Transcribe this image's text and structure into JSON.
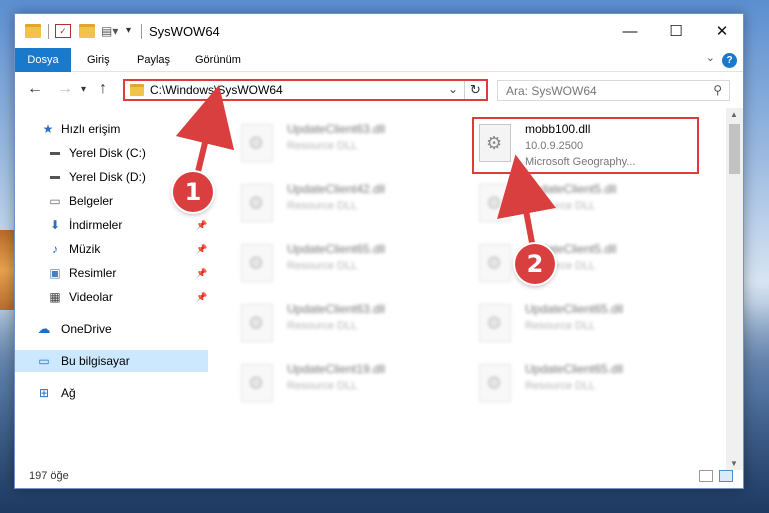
{
  "window": {
    "title": "SysWOW64"
  },
  "ribbon": {
    "tabs": [
      "Dosya",
      "Giriş",
      "Paylaş",
      "Görünüm"
    ]
  },
  "address": {
    "path": "C:\\Windows\\SysWOW64"
  },
  "search": {
    "placeholder": "Ara: SysWOW64"
  },
  "sidebar": {
    "items": [
      {
        "label": "Hızlı erişim",
        "icon": "star-icon"
      },
      {
        "label": "Yerel Disk (C:)",
        "icon": "drive-icon"
      },
      {
        "label": "Yerel Disk (D:)",
        "icon": "drive-icon"
      },
      {
        "label": "Belgeler",
        "icon": "documents-icon"
      },
      {
        "label": "İndirmeler",
        "icon": "download-icon"
      },
      {
        "label": "Müzik",
        "icon": "music-icon"
      },
      {
        "label": "Resimler",
        "icon": "pictures-icon"
      },
      {
        "label": "Videolar",
        "icon": "videos-icon"
      },
      {
        "label": "OneDrive",
        "icon": "cloud-icon"
      },
      {
        "label": "Bu bilgisayar",
        "icon": "computer-icon"
      },
      {
        "label": "Ağ",
        "icon": "network-icon"
      }
    ]
  },
  "files": [
    {
      "name": "UpdateClient63.dll",
      "type": "Resource DLL",
      "blurred": true
    },
    {
      "name": "mobb100.dll",
      "version": "10.0.9.2500",
      "description": "Microsoft Geography...",
      "blurred": false
    },
    {
      "name": "UpdateClient42.dll",
      "type": "Resource DLL",
      "blurred": true
    },
    {
      "name": "UpdateClient5.dll",
      "type": "Resource DLL",
      "blurred": true
    },
    {
      "name": "UpdateClient65.dll",
      "type": "Resource DLL",
      "blurred": true
    },
    {
      "name": "UpdateClient5.dll",
      "type": "Resource DLL",
      "blurred": true
    },
    {
      "name": "UpdateClient63.dll",
      "type": "Resource DLL",
      "blurred": true
    },
    {
      "name": "UpdateClient65.dll",
      "type": "Resource DLL",
      "blurred": true
    },
    {
      "name": "UpdateClient19.dll",
      "type": "Resource DLL",
      "blurred": true
    },
    {
      "name": "UpdateClient65.dll",
      "type": "Resource DLL",
      "blurred": true
    }
  ],
  "status": {
    "count": "197 öğe"
  },
  "callouts": {
    "step1": "1",
    "step2": "2"
  },
  "colors": {
    "accent": "#1979ca",
    "highlight": "#e03b3b",
    "selected": "#cce8ff"
  }
}
